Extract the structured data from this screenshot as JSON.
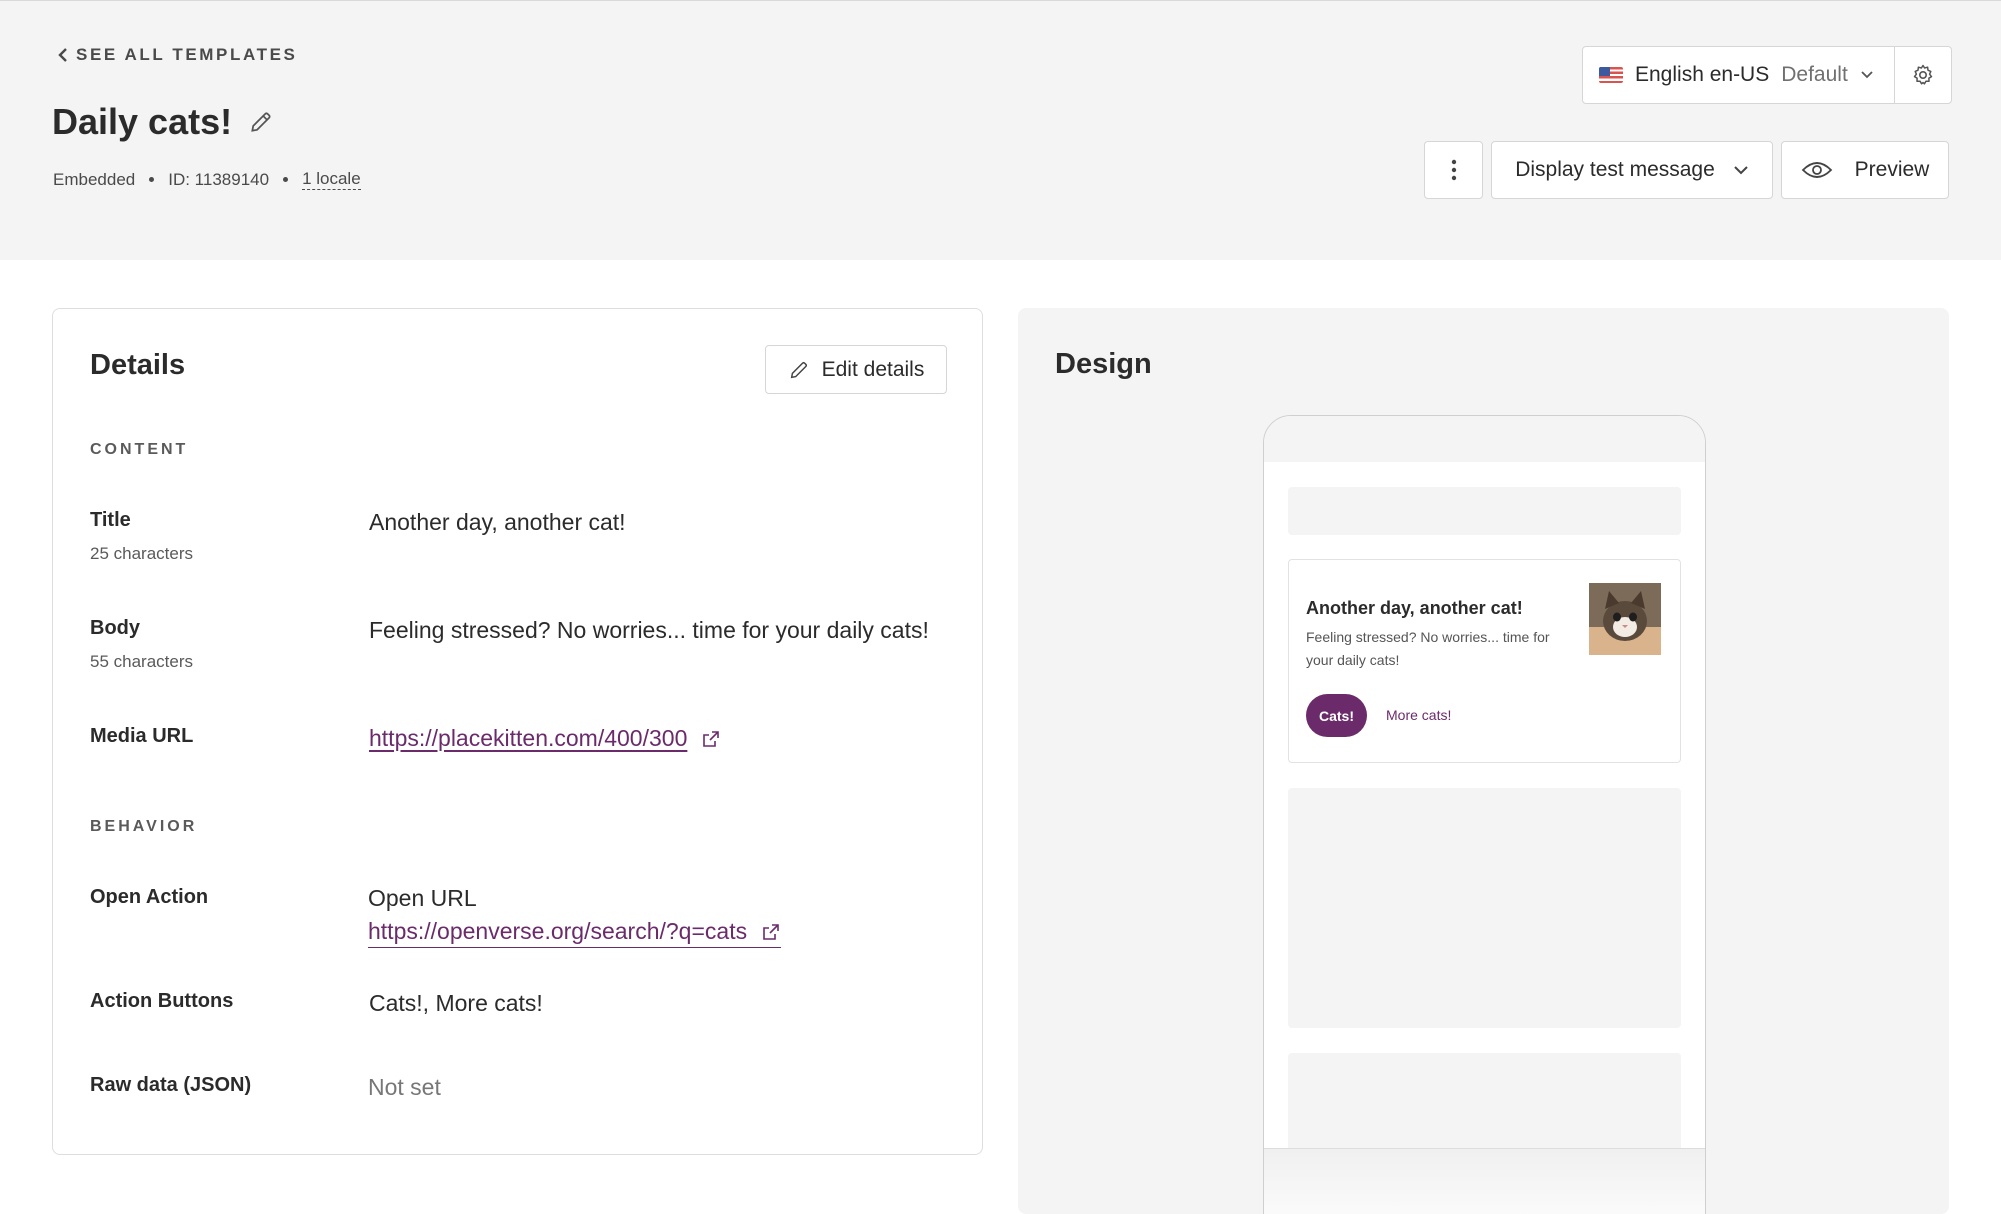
{
  "header": {
    "back_label": "SEE ALL TEMPLATES",
    "title": "Daily cats!",
    "meta": {
      "type": "Embedded",
      "id": "ID: 11389140",
      "locales": "1 locale"
    },
    "locale_select": {
      "language": "English en-US",
      "default_label": "Default"
    },
    "display_test_label": "Display test message",
    "preview_label": "Preview"
  },
  "details": {
    "heading": "Details",
    "edit_label": "Edit details",
    "content_section": "CONTENT",
    "fields": {
      "title": {
        "label": "Title",
        "sub": "25 characters",
        "value": "Another day, another cat!"
      },
      "body": {
        "label": "Body",
        "sub": "55 characters",
        "value": "Feeling stressed? No worries... time for your daily cats!"
      },
      "media_url": {
        "label": "Media URL",
        "value": "https://placekitten.com/400/300"
      }
    },
    "behavior_section": "BEHAVIOR",
    "behavior": {
      "open_action": {
        "label": "Open Action",
        "type": "Open URL",
        "url": "https://openverse.org/search/?q=cats"
      },
      "action_buttons": {
        "label": "Action Buttons",
        "value": "Cats!, More cats!"
      },
      "raw_data": {
        "label": "Raw data (JSON)",
        "value": "Not set"
      }
    }
  },
  "design": {
    "heading": "Design",
    "message": {
      "title": "Another day, another cat!",
      "body": "Feeling stressed? No worries... time for your daily cats!",
      "primary_button": "Cats!",
      "secondary_button": "More cats!"
    }
  },
  "colors": {
    "accent": "#6b2b6b",
    "header_bg": "#f4f4f4",
    "border": "#d6d6d6"
  }
}
